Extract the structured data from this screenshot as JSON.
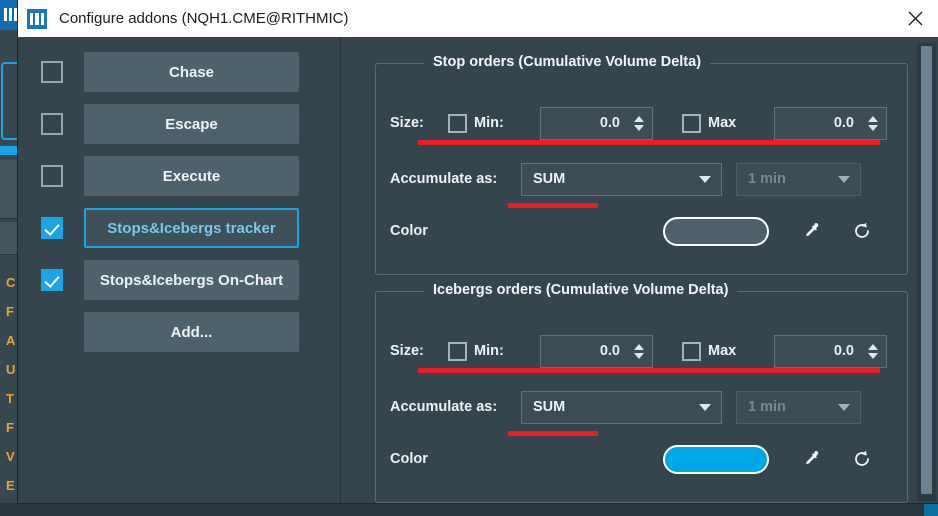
{
  "window": {
    "title": "Configure addons (NQH1.CME@RITHMIC)",
    "app_icon": "columns-icon",
    "close_icon": "close-icon"
  },
  "addons": {
    "items": [
      {
        "label": "Chase",
        "checked": false,
        "focused": false
      },
      {
        "label": "Escape",
        "checked": false,
        "focused": false
      },
      {
        "label": "Execute",
        "checked": false,
        "focused": false
      },
      {
        "label": "Stops&Icebergs tracker",
        "checked": true,
        "focused": true
      },
      {
        "label": "Stops&Icebergs On-Chart",
        "checked": true,
        "focused": false
      },
      {
        "label": "Add...",
        "checked": null,
        "focused": false
      }
    ]
  },
  "groups": [
    {
      "title": "Stop orders (Cumulative Volume Delta)",
      "size_label": "Size:",
      "min_label": "Min:",
      "min_checked": false,
      "min_value": "0.0",
      "max_label": "Max",
      "max_checked": false,
      "max_value": "0.0",
      "accumulate_label": "Accumulate as:",
      "accumulate_value": "SUM",
      "period_value": "1 min",
      "period_disabled": true,
      "color_label": "Color",
      "color_value": "#4d606b",
      "eyedropper_icon": "eyedropper-icon",
      "reset_icon": "reset-icon"
    },
    {
      "title": "Icebergs orders (Cumulative Volume Delta)",
      "size_label": "Size:",
      "min_label": "Min:",
      "min_checked": false,
      "min_value": "0.0",
      "max_label": "Max",
      "max_checked": false,
      "max_value": "0.0",
      "accumulate_label": "Accumulate as:",
      "accumulate_value": "SUM",
      "period_value": "1 min",
      "period_disabled": true,
      "color_label": "Color",
      "color_value": "#00a7e7",
      "eyedropper_icon": "eyedropper-icon",
      "reset_icon": "reset-icon"
    }
  ],
  "annotation_color": "#ee1c25",
  "background": {
    "left_labels": [
      "C",
      "F",
      "A",
      "U",
      "T",
      "F",
      "V",
      "E"
    ]
  }
}
